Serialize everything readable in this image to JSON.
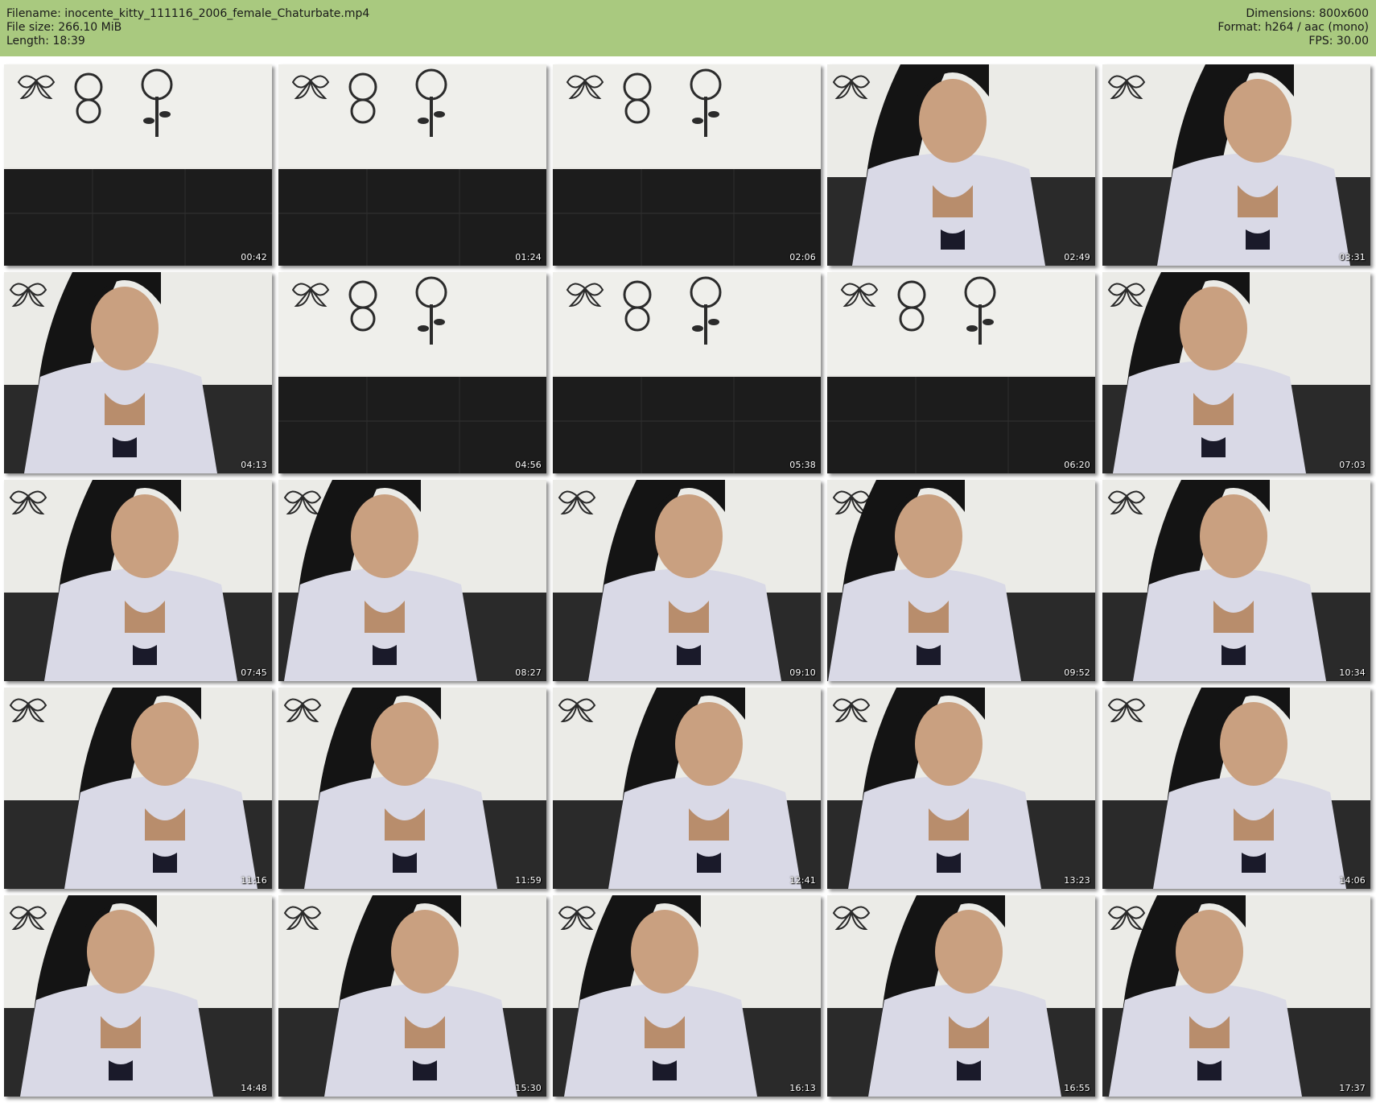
{
  "header": {
    "filename_line": "Filename: inocente_kitty_111116_2006_female_Chaturbate.mp4",
    "filesize_line": "File size: 266.10 MiB",
    "length_line": "Length: 18:39",
    "dimensions_line": "Dimensions: 800x600",
    "format_line": "Format: h264 / aac (mono)",
    "fps_line": "FPS: 30.00",
    "background_color": "#a9c97f"
  },
  "thumbnails": [
    {
      "time": "00:42",
      "scene": "empty-room"
    },
    {
      "time": "01:24",
      "scene": "empty-room"
    },
    {
      "time": "02:06",
      "scene": "empty-room"
    },
    {
      "time": "02:49",
      "scene": "person"
    },
    {
      "time": "03:31",
      "scene": "person"
    },
    {
      "time": "04:13",
      "scene": "person"
    },
    {
      "time": "04:56",
      "scene": "empty-room"
    },
    {
      "time": "05:38",
      "scene": "empty-room"
    },
    {
      "time": "06:20",
      "scene": "empty-room"
    },
    {
      "time": "07:03",
      "scene": "person"
    },
    {
      "time": "07:45",
      "scene": "person"
    },
    {
      "time": "08:27",
      "scene": "person"
    },
    {
      "time": "09:10",
      "scene": "person"
    },
    {
      "time": "09:52",
      "scene": "person"
    },
    {
      "time": "10:34",
      "scene": "person"
    },
    {
      "time": "11:16",
      "scene": "person"
    },
    {
      "time": "11:59",
      "scene": "person"
    },
    {
      "time": "12:41",
      "scene": "person"
    },
    {
      "time": "13:23",
      "scene": "person"
    },
    {
      "time": "14:06",
      "scene": "person"
    },
    {
      "time": "14:48",
      "scene": "person"
    },
    {
      "time": "15:30",
      "scene": "person"
    },
    {
      "time": "16:13",
      "scene": "person"
    },
    {
      "time": "16:55",
      "scene": "person"
    },
    {
      "time": "17:37",
      "scene": "person"
    }
  ]
}
